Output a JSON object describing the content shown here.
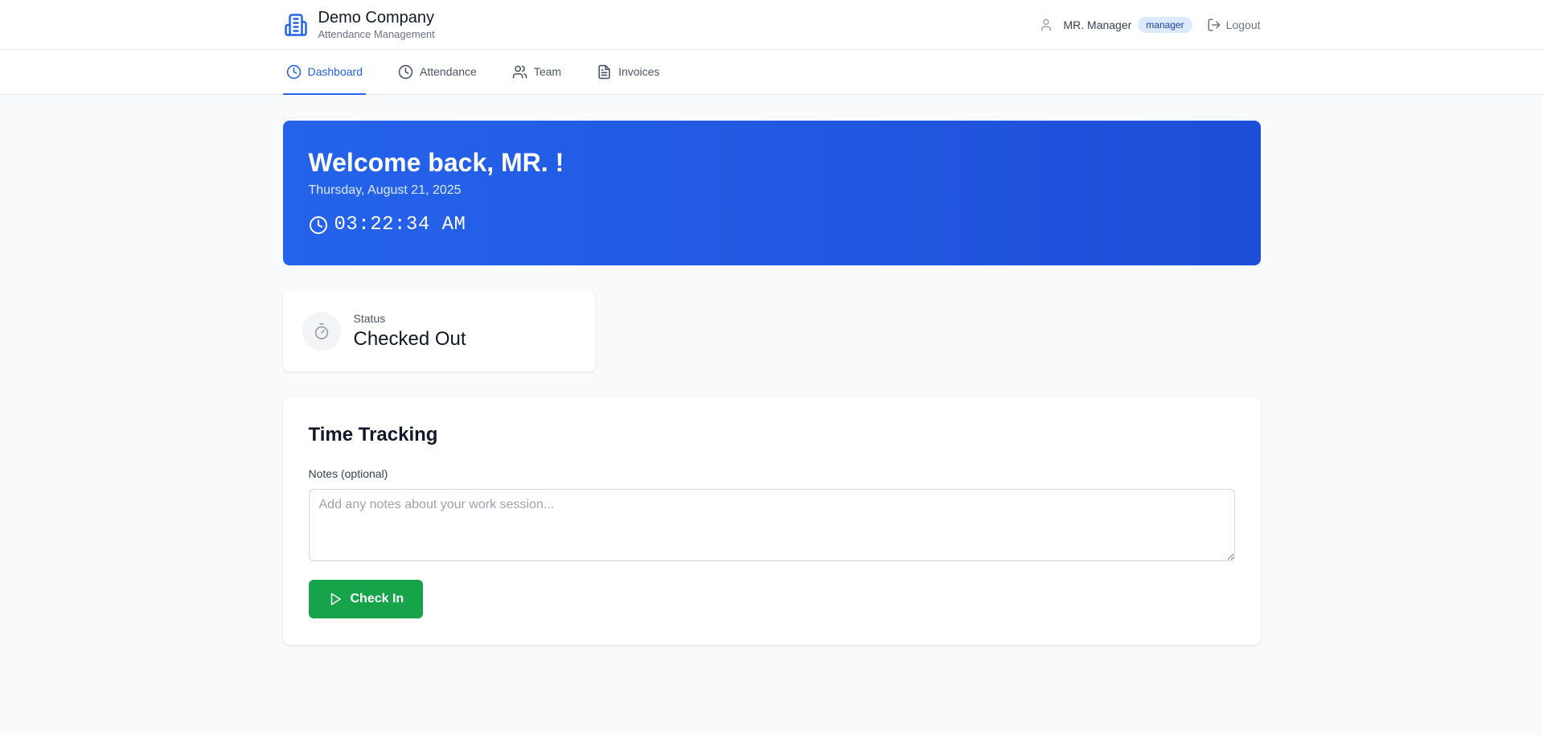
{
  "header": {
    "company": "Demo Company",
    "subtitle": "Attendance Management",
    "user_name": "MR. Manager",
    "role": "manager",
    "logout_label": "Logout"
  },
  "nav": {
    "tabs": [
      {
        "label": "Dashboard",
        "icon": "clock-icon",
        "active": true
      },
      {
        "label": "Attendance",
        "icon": "clock-icon",
        "active": false
      },
      {
        "label": "Team",
        "icon": "users-icon",
        "active": false
      },
      {
        "label": "Invoices",
        "icon": "file-text-icon",
        "active": false
      }
    ]
  },
  "welcome": {
    "title": "Welcome back, MR. !",
    "date": "Thursday, August 21, 2025",
    "time": "03:22:34 AM"
  },
  "status": {
    "label": "Status",
    "value": "Checked Out"
  },
  "tracking": {
    "title": "Time Tracking",
    "notes_label": "Notes (optional)",
    "notes_placeholder": "Add any notes about your work session...",
    "notes_value": "",
    "checkin_label": "Check In"
  },
  "colors": {
    "primary": "#2563eb",
    "success": "#16a34a",
    "background": "#f9fafb"
  }
}
